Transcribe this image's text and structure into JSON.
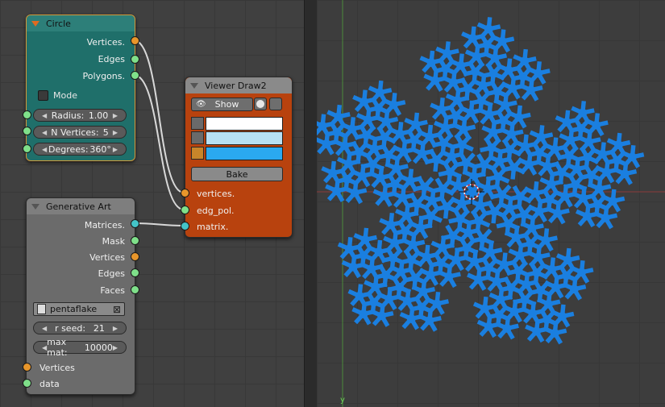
{
  "nodes": {
    "circle": {
      "title": "Circle",
      "outputs": [
        "Vertices.",
        "Edges",
        "Polygons."
      ],
      "mode_label": "Mode",
      "fields": [
        {
          "label": "Radius:",
          "value": "1.00"
        },
        {
          "label": "N Vertices:",
          "value": "5"
        },
        {
          "label": "Degrees:",
          "value": "360°"
        }
      ]
    },
    "generative_art": {
      "title": "Generative Art",
      "outputs": [
        "Matrices.",
        "Mask",
        "Vertices",
        "Edges",
        "Faces"
      ],
      "file_name": "pentaflake",
      "fields": [
        {
          "label": "r seed:",
          "value": "21"
        },
        {
          "label": "max mat:",
          "value": "10000"
        }
      ],
      "inputs": [
        "Vertices",
        "data"
      ]
    },
    "viewer": {
      "title": "Viewer Draw2",
      "show_label": "Show",
      "bake_label": "Bake",
      "inputs": [
        "vertices.",
        "edg_pol.",
        "matrix."
      ],
      "swatch_colors": [
        "#ffffff",
        "#b7dff2",
        "#2aa9f0"
      ]
    }
  },
  "viewport": {
    "shape_color": "#1a7fe0",
    "y_axis_label": "y"
  },
  "colors": {
    "circle_node": "#1f6f6a",
    "viewer_node": "#b8420e",
    "gen_node": "#6b6b6b",
    "socket_orange": "#e8962b",
    "socket_green": "#7fe08a",
    "socket_cyan": "#44c4c8"
  }
}
